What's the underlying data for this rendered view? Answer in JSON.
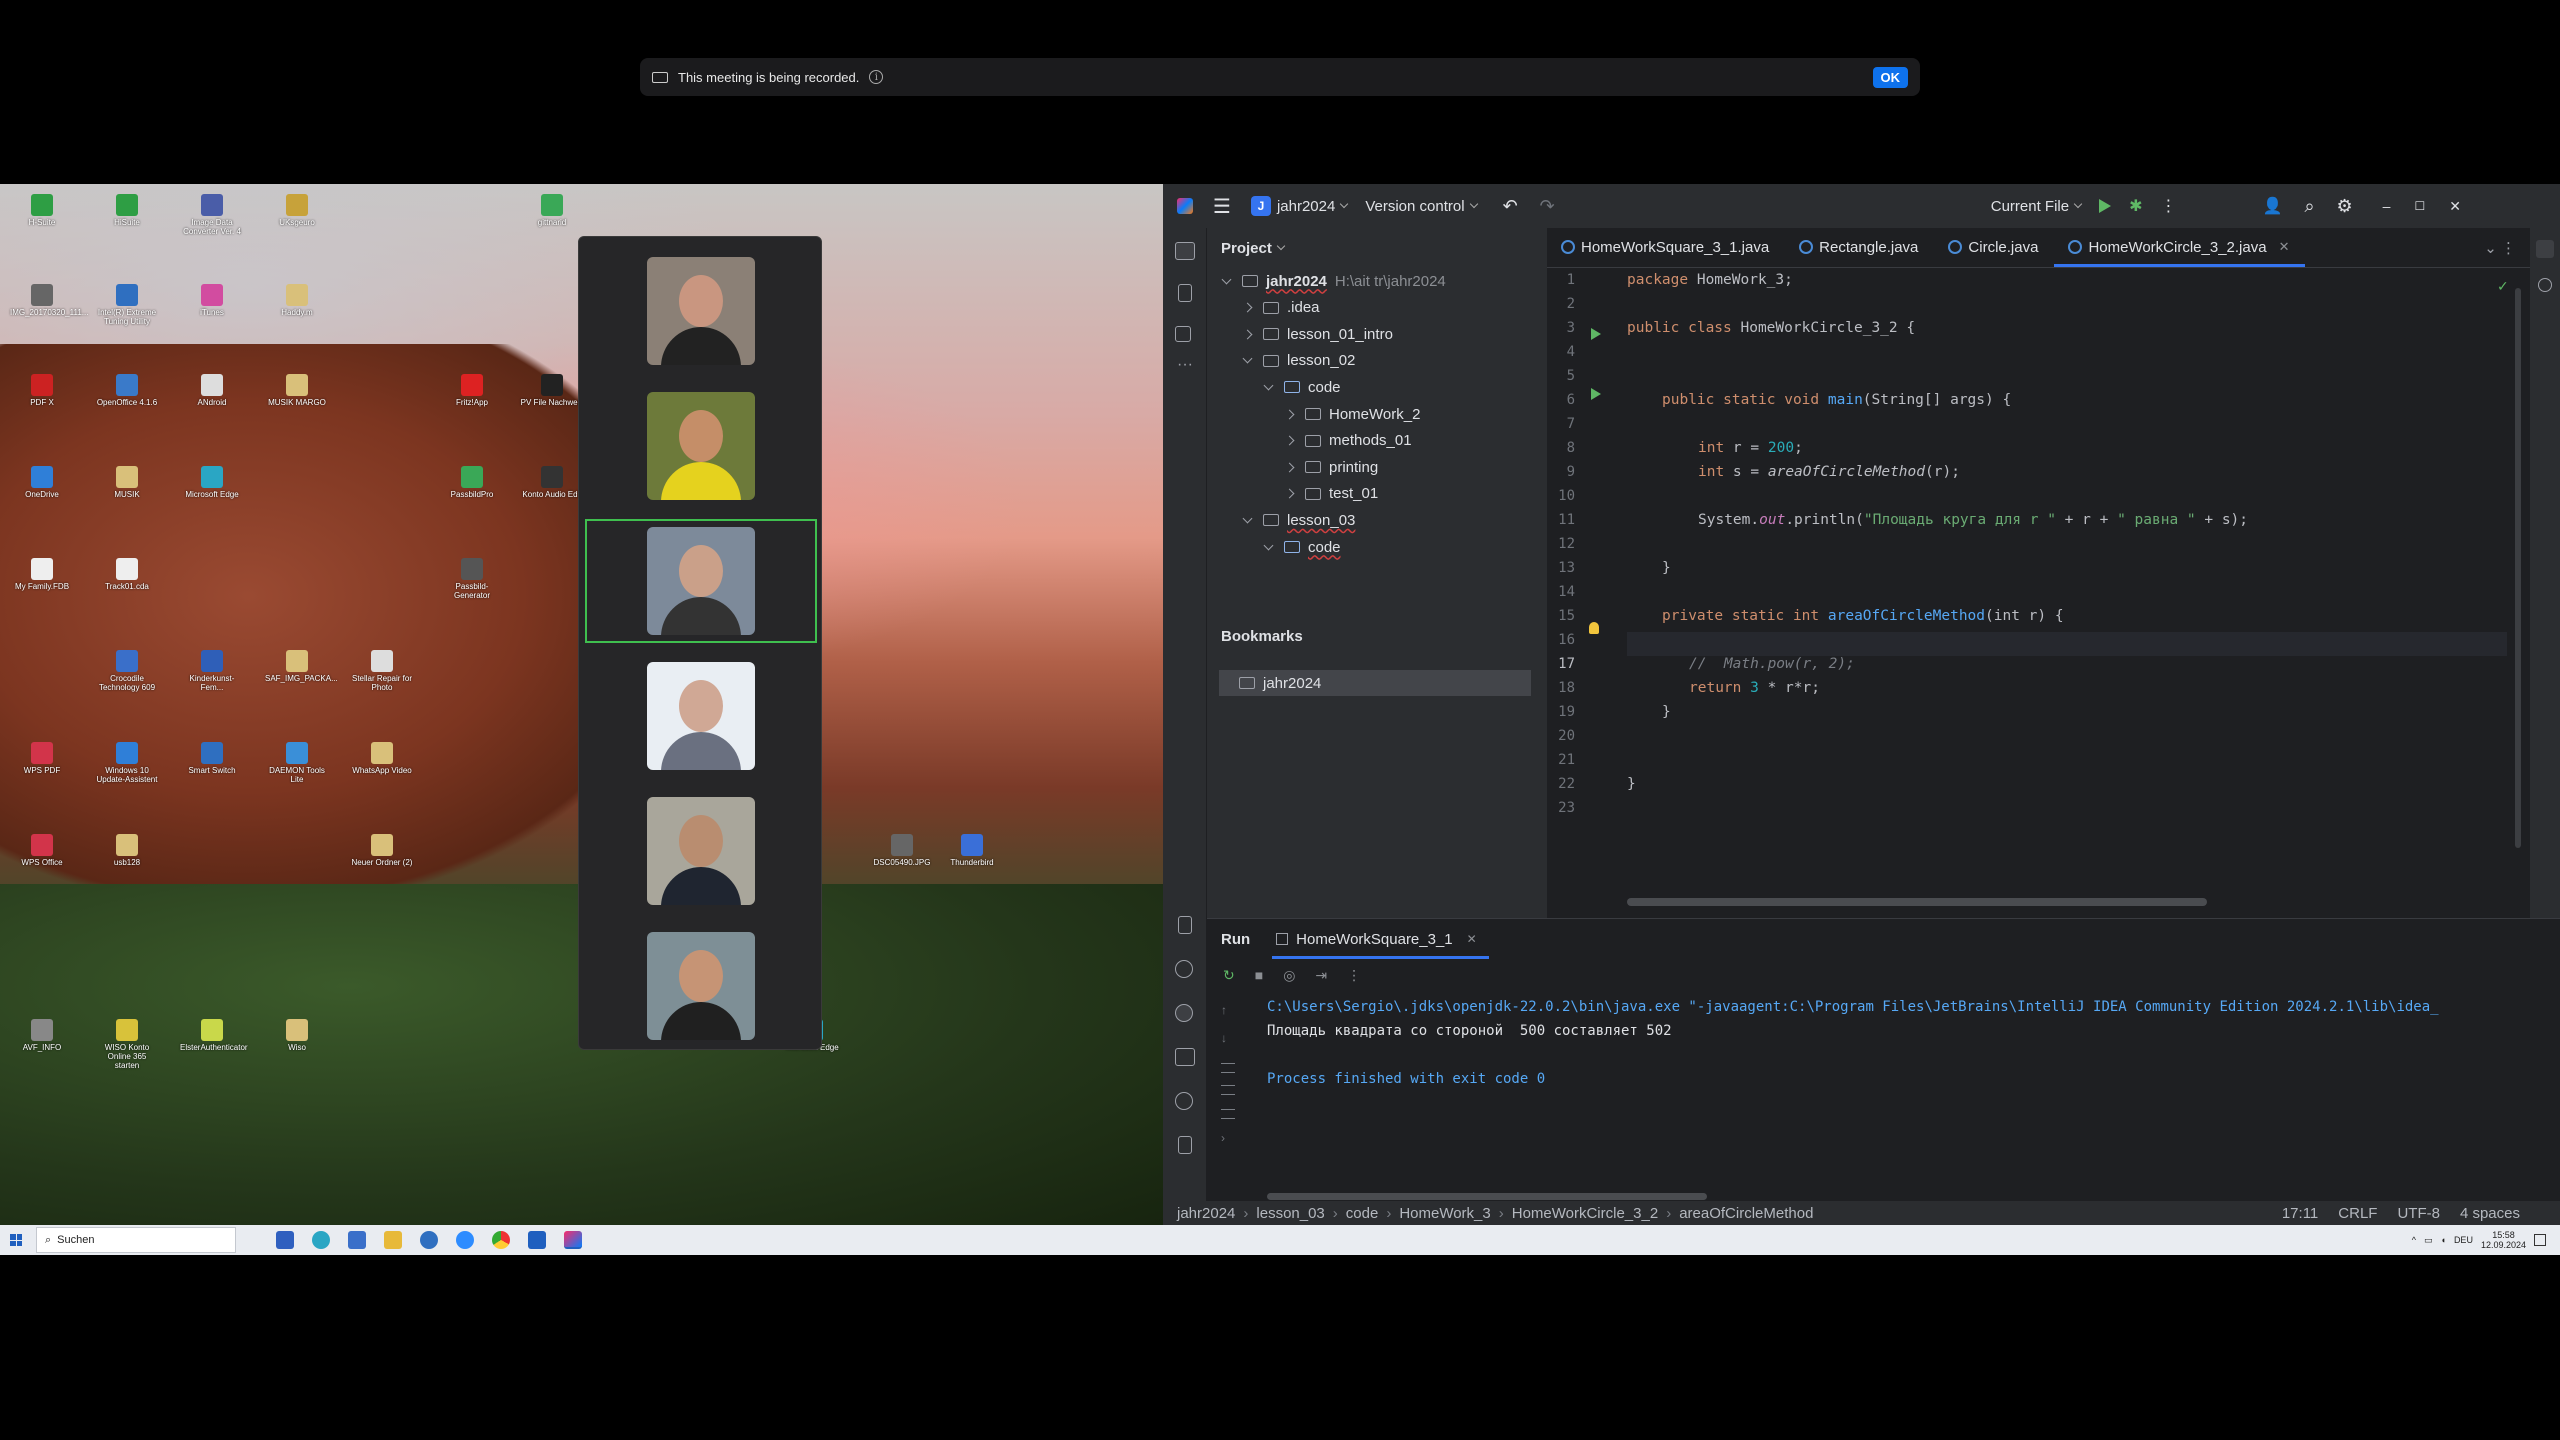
{
  "recording_banner": {
    "message": "This meeting is being recorded.",
    "ok_label": "OK"
  },
  "desktop": {
    "icons": [
      {
        "label": "H-Suite",
        "color": "#2e9e44"
      },
      {
        "label": "HiSuite",
        "color": "#2e9e44"
      },
      {
        "label": "Image Data Converter Ver. 4",
        "color": "#4a5da8"
      },
      {
        "label": "UKsgeuro",
        "color": "#c7a23a"
      },
      {
        "label": "gittnarid",
        "color": "#3aa857"
      },
      {
        "label": "IMG_20170320_111...",
        "color": "#666"
      },
      {
        "label": "Intel(R) Extreme Tuning Utility",
        "color": "#2f6fc0"
      },
      {
        "label": "iTunes",
        "color": "#d24ca0"
      },
      {
        "label": "Haddy.m",
        "color": "#d9c07a"
      },
      {
        "label": "PDF X",
        "color": "#c22"
      },
      {
        "label": "OpenOffice 4.1.6",
        "color": "#3a7ac9"
      },
      {
        "label": "ANdroid",
        "color": "#ddd"
      },
      {
        "label": "MUSIK MARGO",
        "color": "#d9c07a"
      },
      {
        "label": "OneDrive",
        "color": "#2f7fd8"
      },
      {
        "label": "MUSIK",
        "color": "#d9c07a"
      },
      {
        "label": "Microsoft Edge",
        "color": "#2aa6c4"
      },
      {
        "label": "My Family.FDB",
        "color": "#eee"
      },
      {
        "label": "Track01.cda",
        "color": "#eee"
      },
      {
        "label": "Crocodile Technology 609",
        "color": "#3a6fc9"
      },
      {
        "label": "Kinderkunst-Fem...",
        "color": "#2f5fb8"
      },
      {
        "label": "SAF_IMG_PACKA...",
        "color": "#d9c07a"
      },
      {
        "label": "Stellar Repair for Photo",
        "color": "#ddd"
      },
      {
        "label": "WPS PDF",
        "color": "#d2344a"
      },
      {
        "label": "Windows 10 Update-Assistent",
        "color": "#2f7fd8"
      },
      {
        "label": "Smart Switch",
        "color": "#2f6fc0"
      },
      {
        "label": "DAEMON Tools Lite",
        "color": "#3a8fd8"
      },
      {
        "label": "WhatsApp Video",
        "color": "#d9c07a"
      },
      {
        "label": "WPS Office",
        "color": "#d2344a"
      },
      {
        "label": "usb128",
        "color": "#d9c07a"
      },
      {
        "label": "Neuer Ordner (2)",
        "color": "#d9c07a"
      },
      {
        "label": "AVF_INFO",
        "color": "#888"
      },
      {
        "label": "WISO Konto Online 365 starten",
        "color": "#d8c23a"
      },
      {
        "label": "ElsterAuthenticator",
        "color": "#c9d84a"
      },
      {
        "label": "Wiso",
        "color": "#d9c07a"
      },
      {
        "label": "Microsoft Edge",
        "color": "#2aa6c4"
      },
      {
        "label": "Thunderbird",
        "color": "#3a6fd8"
      },
      {
        "label": "DSC05490.JPG",
        "color": "#666"
      },
      {
        "label": "Passbild-Generator",
        "color": "#555"
      },
      {
        "label": "PassbildPro",
        "color": "#3aa857"
      },
      {
        "label": "Konto Audio Edit",
        "color": "#333"
      },
      {
        "label": "Fritz!App",
        "color": "#d22"
      },
      {
        "label": "PV File Nachweis",
        "color": "#222"
      }
    ]
  },
  "gallery": {
    "participants": [
      {
        "name": "participant-1",
        "skin": "#c99680",
        "shirt": "#222",
        "bg": "#8b8076",
        "active": false
      },
      {
        "name": "participant-2",
        "skin": "#c58e68",
        "shirt": "#e5d21e",
        "bg": "#6d7a3a",
        "active": false
      },
      {
        "name": "participant-3",
        "skin": "#caa089",
        "shirt": "#333",
        "bg": "#7d8a9a",
        "active": true
      },
      {
        "name": "participant-4",
        "skin": "#d0a895",
        "shirt": "#6a7080",
        "bg": "#e9eef3",
        "active": false
      },
      {
        "name": "participant-5",
        "skin": "#b98d70",
        "shirt": "#1f2530",
        "bg": "#a9a69b",
        "active": false
      },
      {
        "name": "participant-6",
        "skin": "#c69475",
        "shirt": "#202020",
        "bg": "#7e8f96",
        "active": false
      }
    ]
  },
  "ide": {
    "project_badge": "J",
    "project_name": "jahr2024",
    "version_control": "Version control",
    "run_config": "Current File",
    "project_panel": {
      "title": "Project",
      "tree": [
        {
          "label": "jahr2024",
          "path": "H:\\ait tr\\jahr2024",
          "indent": 0,
          "state": "open",
          "underline": true
        },
        {
          "label": ".idea",
          "indent": 1,
          "state": "closed"
        },
        {
          "label": "lesson_01_intro",
          "indent": 1,
          "state": "closed"
        },
        {
          "label": "lesson_02",
          "indent": 1,
          "state": "open"
        },
        {
          "label": "code",
          "indent": 2,
          "state": "open"
        },
        {
          "label": "HomeWork_2",
          "indent": 3,
          "state": "closed"
        },
        {
          "label": "methods_01",
          "indent": 3,
          "state": "closed"
        },
        {
          "label": "printing",
          "indent": 3,
          "state": "closed"
        },
        {
          "label": "test_01",
          "indent": 3,
          "state": "closed"
        },
        {
          "label": "lesson_03",
          "indent": 1,
          "state": "open",
          "underline": true
        },
        {
          "label": "code",
          "indent": 2,
          "state": "open",
          "underline": true
        }
      ],
      "bookmarks_title": "Bookmarks",
      "bookmark": "jahr2024"
    },
    "tabs": [
      {
        "label": "HomeWorkSquare_3_1.java",
        "active": false
      },
      {
        "label": "Rectangle.java",
        "active": false
      },
      {
        "label": "Circle.java",
        "active": false
      },
      {
        "label": "HomeWorkCircle_3_2.java",
        "active": true
      }
    ],
    "code_lines": [
      "1",
      "2",
      "3",
      "4",
      "5",
      "6",
      "7",
      "8",
      "9",
      "10",
      "11",
      "12",
      "13",
      "14",
      "15",
      "16",
      "17",
      "18",
      "19",
      "20",
      "21",
      "22",
      "23"
    ],
    "code": {
      "l1_kw": "package",
      "l1_rest": " HomeWork_3;",
      "l3_kw": "public class",
      "l3_rest": " HomeWorkCircle_3_2 {",
      "l6_kw": "public static void",
      "l6_fn": "main",
      "l6_rest": "(String[] args) {",
      "l8_kw": "int",
      "l8_a": " r = ",
      "l8_num": "200",
      "l8_b": ";",
      "l9_kw": "int",
      "l9_a": " s = ",
      "l9_fn": "areaOfCircleMethod",
      "l9_b": "(r);",
      "l11_a": "System.",
      "l11_static": "out",
      "l11_b": ".println(",
      "l11_s1": "\"Площадь круга для r \"",
      "l11_c": " + r + ",
      "l11_s2": "\" равна \"",
      "l11_d": " + s);",
      "l13": "}",
      "l15_kw": "private static int",
      "l15_fn": "areaOfCircleMethod",
      "l15_rest": "(int r) {",
      "l17_cmt": "//  Math.pow(r, 2);",
      "l18_kw": "return",
      "l18_a": " ",
      "l18_num": "3",
      "l18_b": " * r*r;",
      "l19": "}",
      "l22": "}"
    },
    "run": {
      "title": "Run",
      "tab": "HomeWorkSquare_3_1",
      "cmd": "C:\\Users\\Sergio\\.jdks\\openjdk-22.0.2\\bin\\java.exe \"-javaagent:C:\\Program Files\\JetBrains\\IntelliJ IDEA Community Edition 2024.2.1\\lib\\idea_",
      "output": "Площадь квадрата со стороной  500 составляет 502",
      "finish": "Process finished with exit code 0"
    },
    "statusbar": {
      "crumbs": [
        "jahr2024",
        "lesson_03",
        "code",
        "HomeWork_3",
        "HomeWorkCircle_3_2",
        "areaOfCircleMethod"
      ],
      "position": "17:11",
      "line_sep": "CRLF",
      "encoding": "UTF-8",
      "indent": "4 spaces"
    }
  },
  "taskbar": {
    "search_placeholder": "Suchen",
    "lang": "DEU",
    "time": "15:58",
    "date": "12.09.2024"
  }
}
